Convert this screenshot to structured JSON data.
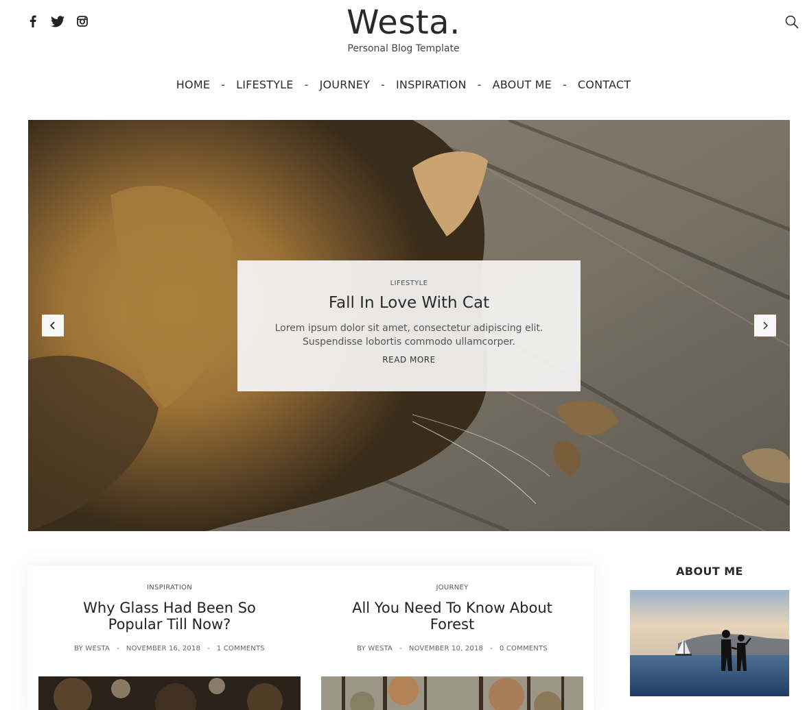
{
  "header": {
    "brand_title": "Westa.",
    "brand_subtitle": "Personal Blog Template",
    "social_icons": [
      "facebook-icon",
      "twitter-icon",
      "instagram-icon"
    ],
    "search_icon": "search-icon"
  },
  "nav": {
    "items": [
      {
        "label": "HOME"
      },
      {
        "label": "LIFESTYLE"
      },
      {
        "label": "JOURNEY"
      },
      {
        "label": "INSPIRATION"
      },
      {
        "label": "ABOUT ME"
      },
      {
        "label": "CONTACT"
      }
    ],
    "separator": "-"
  },
  "slider": {
    "category": "LIFESTYLE",
    "title": "Fall In Love With Cat",
    "excerpt": "Lorem ipsum dolor sit amet, consectetur adipiscing elit. Suspendisse lobortis commodo ullamcorper.",
    "read_more": "READ MORE",
    "prev_icon": "chevron-left-icon",
    "next_icon": "chevron-right-icon"
  },
  "posts": [
    {
      "category": "INSPIRATION",
      "title": "Why Glass Had Been So Popular Till Now?",
      "author": "BY WESTA",
      "date": "NOVEMBER 16, 2018",
      "comments": "1 COMMENTS"
    },
    {
      "category": "JOURNEY",
      "title": "All You Need To Know About Forest",
      "author": "BY WESTA",
      "date": "NOVEMBER 10, 2018",
      "comments": "0 COMMENTS"
    }
  ],
  "meta_separator": "-",
  "sidebar": {
    "about_title": "ABOUT ME"
  },
  "colors": {
    "text": "#222222",
    "muted": "#666666",
    "card_bg": "#f5f5f5"
  }
}
